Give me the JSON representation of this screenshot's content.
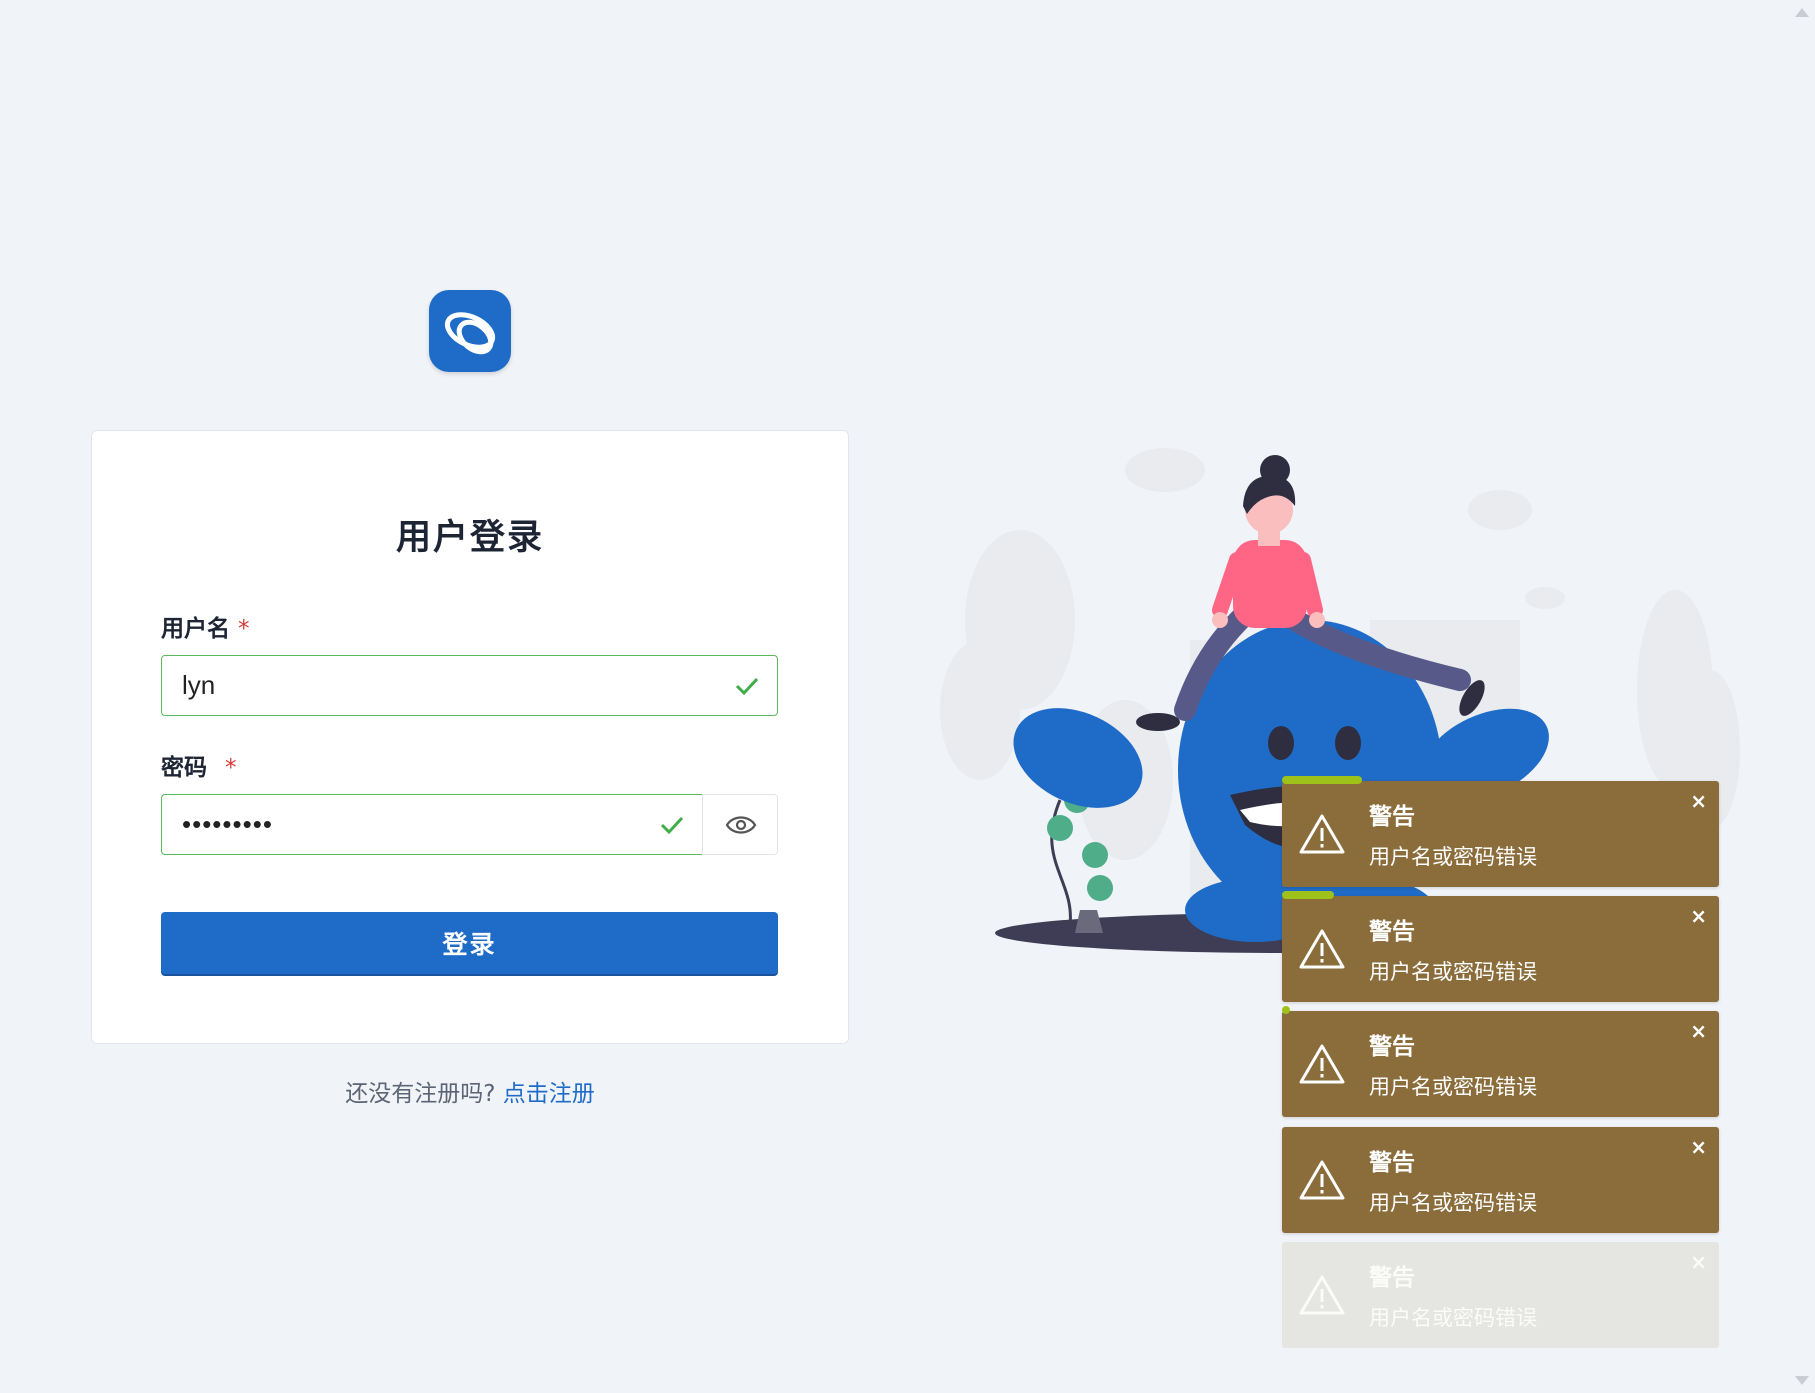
{
  "login": {
    "title": "用户登录",
    "username_label": "用户名",
    "username_value": "lyn",
    "password_label": "密码",
    "password_value": "•••••••••",
    "required_mark": "*",
    "submit_label": "登录"
  },
  "register": {
    "prompt": "还没有注册吗?",
    "link": "点击注册"
  },
  "colors": {
    "primary": "#1f6cc8",
    "valid": "#5cb85c",
    "toast_bg": "#8b6d3c",
    "toast_progress": "#9fc21b",
    "background": "#f0f3f8"
  },
  "toasts": [
    {
      "title": "警告",
      "message": "用户名或密码错误",
      "close": "×",
      "progress": 0.18
    },
    {
      "title": "警告",
      "message": "用户名或密码错误",
      "close": "×",
      "progress": 0.12
    },
    {
      "title": "警告",
      "message": "用户名或密码错误",
      "close": "×",
      "progress": 0.01
    },
    {
      "title": "警告",
      "message": "用户名或密码错误",
      "close": "×",
      "progress": 0
    },
    {
      "title": "警告",
      "message": "用户名或密码错误",
      "close": "×",
      "progress": 0
    }
  ],
  "icons": {
    "logo": "app-logo",
    "valid": "check-icon",
    "toggle_password": "eye-icon",
    "toast": "warning-icon"
  }
}
